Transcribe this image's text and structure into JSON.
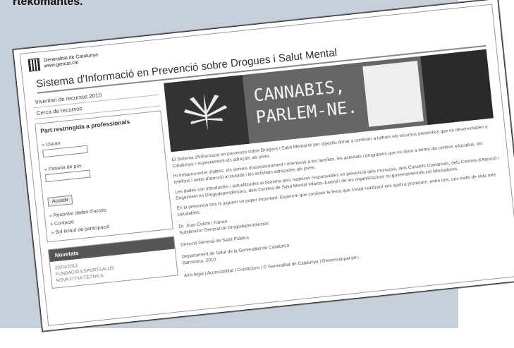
{
  "caption": "rtekomantes.",
  "header": {
    "logo_line1": "Generalitat de Catalunya",
    "logo_line2": "www.gencat.cat",
    "site_title": "Sistema d'Informació en Prevenció sobre Drogues i Salut Mental"
  },
  "sidebar": {
    "nav": [
      {
        "label": "Inventari de recursos 2010"
      },
      {
        "label": "Cerca de recursos"
      }
    ],
    "login": {
      "heading": "Part restringida a professionals",
      "user_label": "» Usuari",
      "password_label": "» Paraula de pas",
      "submit_label": "Accedir"
    },
    "links": [
      {
        "label": "» Recordar dades d'accés"
      },
      {
        "label": "» Contacte"
      },
      {
        "label": "» Sol·licitud de participació"
      }
    ],
    "news": {
      "heading": "Novetats",
      "date": "23/01/2012",
      "title": "FUNDACIÓ ESPORTSALUS",
      "subtitle": "NOVA FITXA TÈCNICA"
    }
  },
  "banner": {
    "line1": "CANNABIS,",
    "line2": "PARLEM-NE."
  },
  "main": {
    "paragraphs": [
      "El Sistema d'Informació en prevenció sobre Drogues i Salut Mental té per objectiu donar a conèixer a tothom els recursos preventius que es desenvolupen a Catalunya, i especialment els adreçats als joves.",
      "Hi trobareu entre d'altres: els serveis d'assessorament i orientació a les famílies, les activitats i programes que es duen a terme als centres educatius, els telèfons i webs d'atenció al ciutadà i les activitats adreçades als joves.",
      "Les dades són introduïdes i actualitzades al Sistema pels mateixos responsables en prevenció dels municipis, dels Consells Comarcals, dels Centres d'Atenció i Seguiment en Drogodependències, dels Centres de Salut Mental Infanto-Juvenil i de les organitzacions no governamentals col·laboradores.",
      "En la prevenció tots hi juguem un paper important. Esperem que conèixer la feina que s'està realitzant ens ajudi a promoure, entre tots, uns estils de vida més saludables."
    ],
    "signature": [
      "Dr. Joan Colom i Farran",
      "Subdirector General de Drogodependències",
      "Direcció General de Salut Pública",
      "Departament de Salut de la Generalitat de Catalunya",
      "Barcelona, 2010"
    ],
    "footer": "Avís legal | Accessibilitat | Condicions | © Generalitat de Catalunya | Desenvolupat per..."
  }
}
